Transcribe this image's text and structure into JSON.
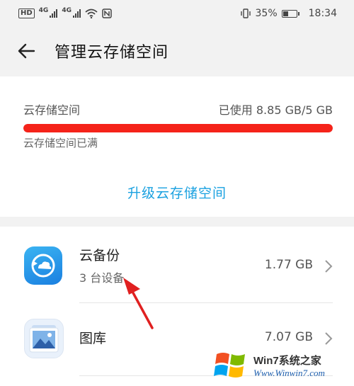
{
  "status_bar": {
    "hd_label": "HD",
    "net_1": "4G",
    "net_2": "4G",
    "battery_percent": "35%",
    "time": "18:34"
  },
  "header": {
    "title": "管理云存储空间",
    "back_icon": "back-arrow-icon"
  },
  "storage": {
    "label": "云存储空间",
    "used_text": "已使用 8.85 GB/5 GB",
    "usage_fraction": 1.0,
    "status": "云存储空间已满",
    "upgrade_label": "升级云存储空间",
    "bar_color": "#f5231a",
    "link_color": "#1aa1e0"
  },
  "items": [
    {
      "title": "云备份",
      "subtitle": "3 台设备",
      "size": "1.77 GB",
      "icon": "cloud-backup-icon"
    },
    {
      "title": "图库",
      "size": "7.07 GB",
      "icon": "gallery-icon"
    }
  ],
  "watermark": {
    "line1": "Win7系统之家",
    "line2": "Www.Winwin7.com"
  }
}
